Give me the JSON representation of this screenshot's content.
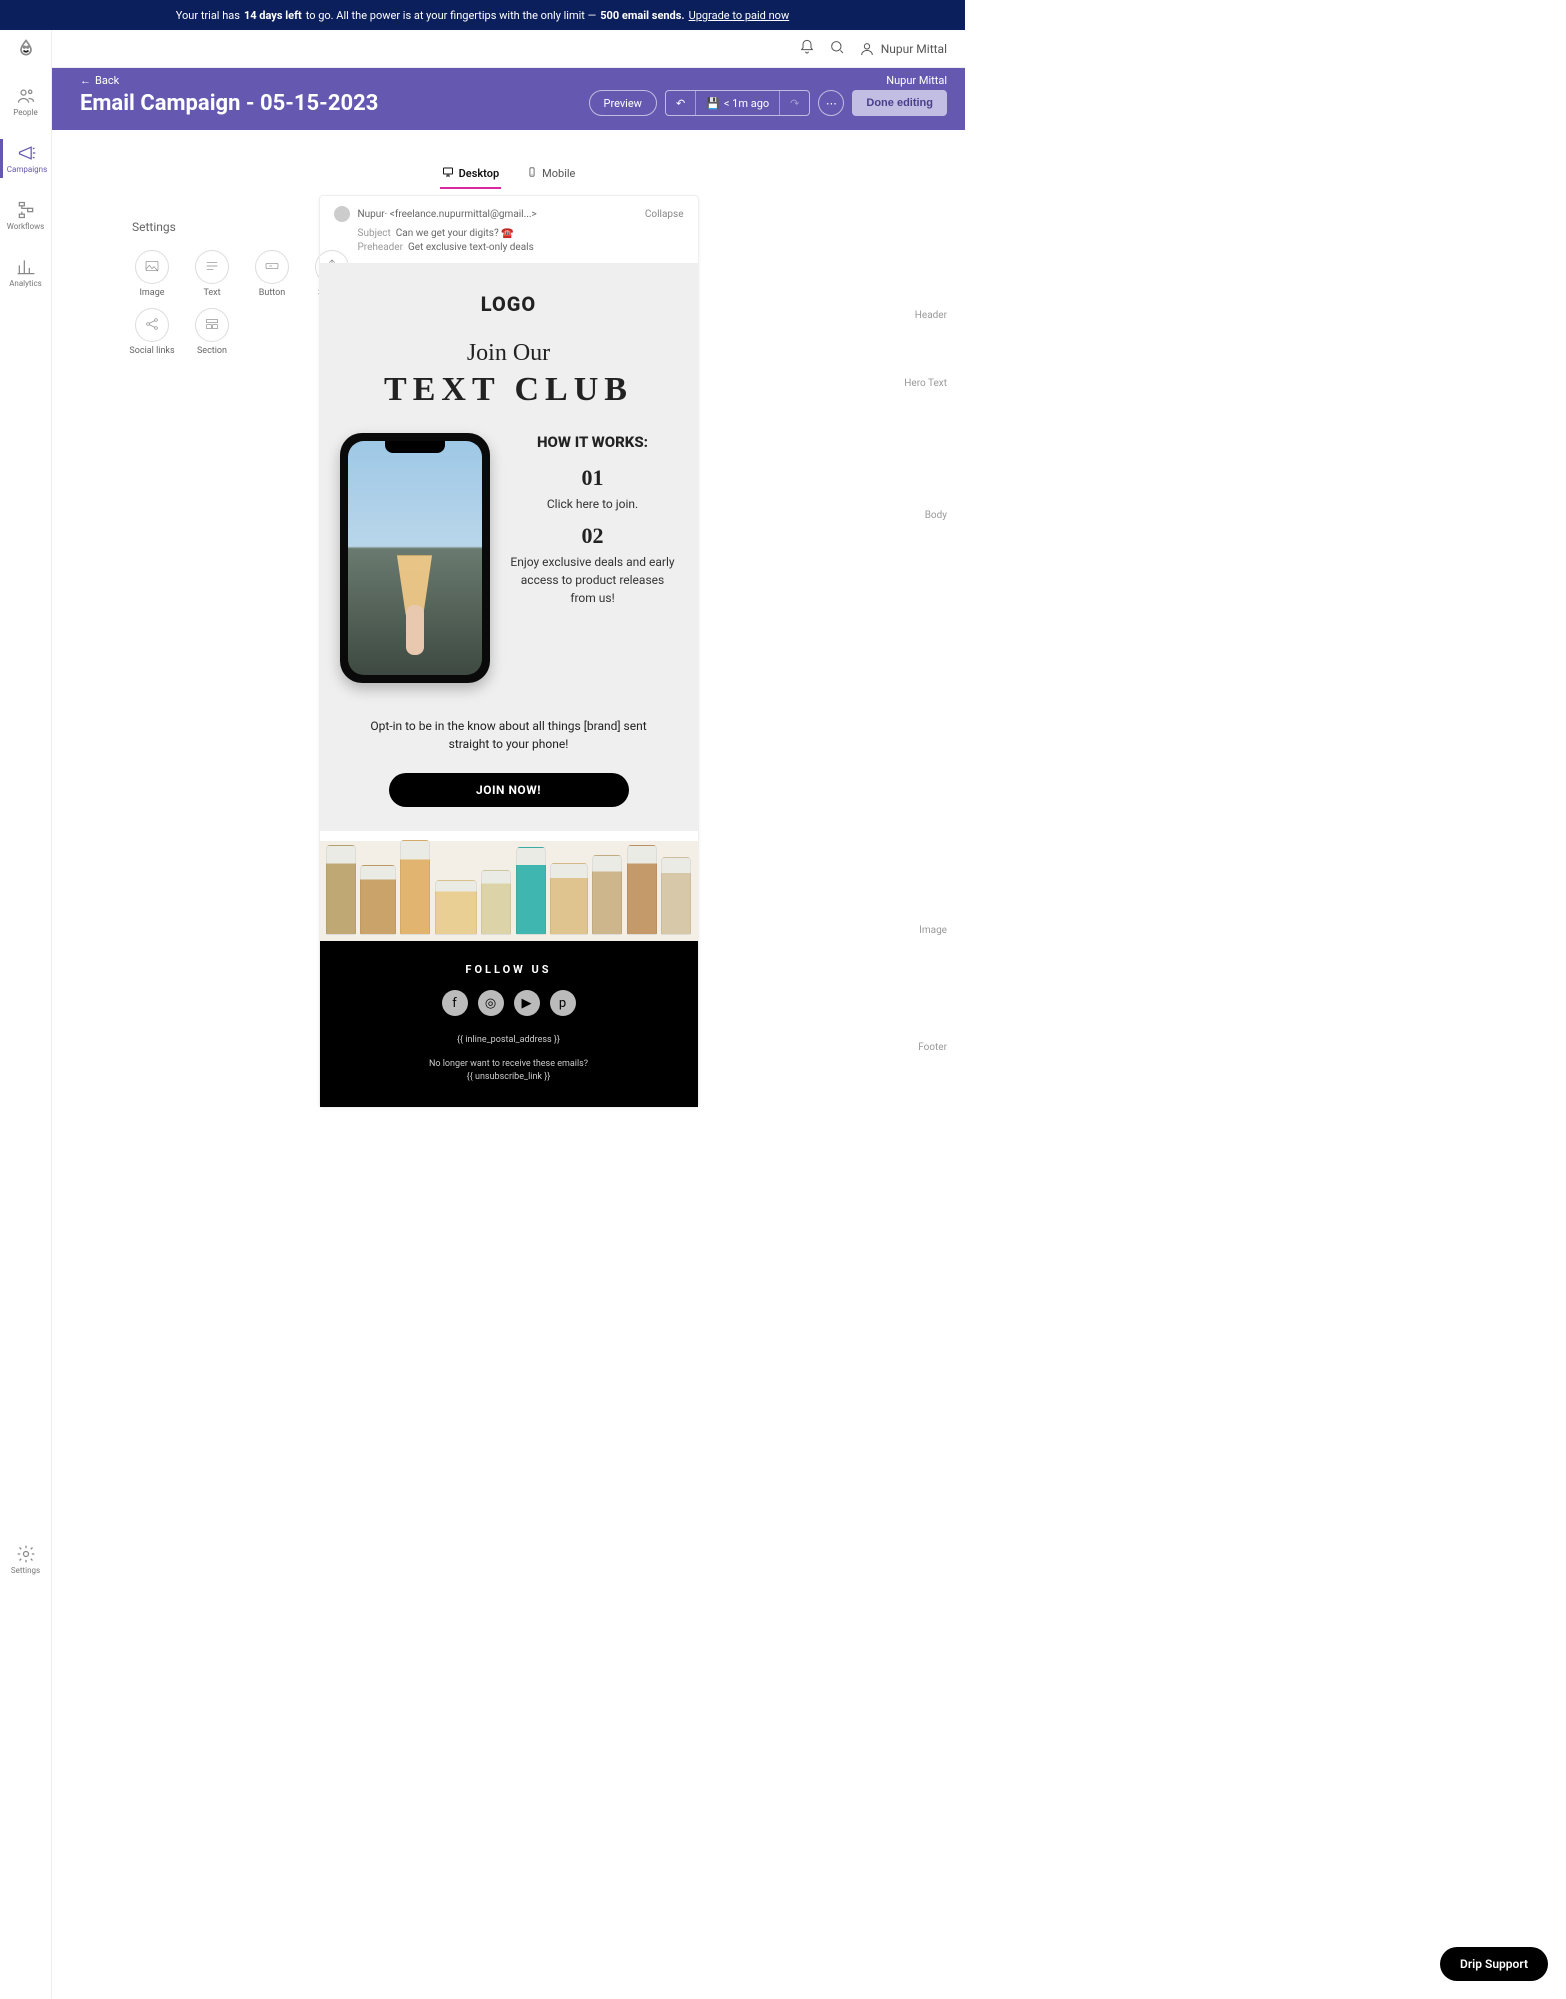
{
  "trial": {
    "prefix": "Your trial has",
    "days": "14 days left",
    "middle": "to go. All the power is at your fingertips with the only limit —",
    "limit": "500 email sends.",
    "upgrade": "Upgrade to paid now"
  },
  "topbar": {
    "user": "Nupur Mittal"
  },
  "header": {
    "back": "Back",
    "title": "Email Campaign - 05-15-2023",
    "author": "Nupur Mittal",
    "preview": "Preview",
    "saved": "< 1m ago",
    "done": "Done editing"
  },
  "side": {
    "items": [
      {
        "label": "People"
      },
      {
        "label": "Campaigns"
      },
      {
        "label": "Workflows"
      },
      {
        "label": "Analytics"
      }
    ],
    "settings": "Settings"
  },
  "settings": {
    "title": "Settings",
    "components": [
      {
        "label": "Image"
      },
      {
        "label": "Text"
      },
      {
        "label": "Button"
      },
      {
        "label": "Spacer"
      },
      {
        "label": "Social links"
      },
      {
        "label": "Section"
      }
    ]
  },
  "tabs": {
    "desktop": "Desktop",
    "mobile": "Mobile"
  },
  "emailMeta": {
    "from": "Nupur· <freelance.nupurmittal@gmail...>",
    "collapse": "Collapse",
    "subjectLabel": "Subject",
    "subject": "Can we get your digits? ☎️",
    "preheaderLabel": "Preheader",
    "preheader": "Get exclusive text-only deals"
  },
  "email": {
    "logo": "LOGO",
    "join": "Join Our",
    "club": "TEXT CLUB",
    "howTitle": "HOW IT WORKS:",
    "step1num": "01",
    "step1": "Click here to join.",
    "step2num": "02",
    "step2": "Enjoy exclusive deals and early access to product releases from us!",
    "optin": "Opt-in to be in the know about all things [brand] sent straight to your phone!",
    "cta": "JOIN NOW!",
    "follow": "FOLLOW US",
    "addr": "{{ inline_postal_address }}",
    "unsub1": "No longer want to receive these emails?",
    "unsub2": "{{ unsubscribe_link }}"
  },
  "regions": {
    "header": "Header",
    "hero": "Hero Text",
    "body": "Body",
    "image": "Image",
    "footer": "Footer"
  },
  "support": "Drip Support"
}
